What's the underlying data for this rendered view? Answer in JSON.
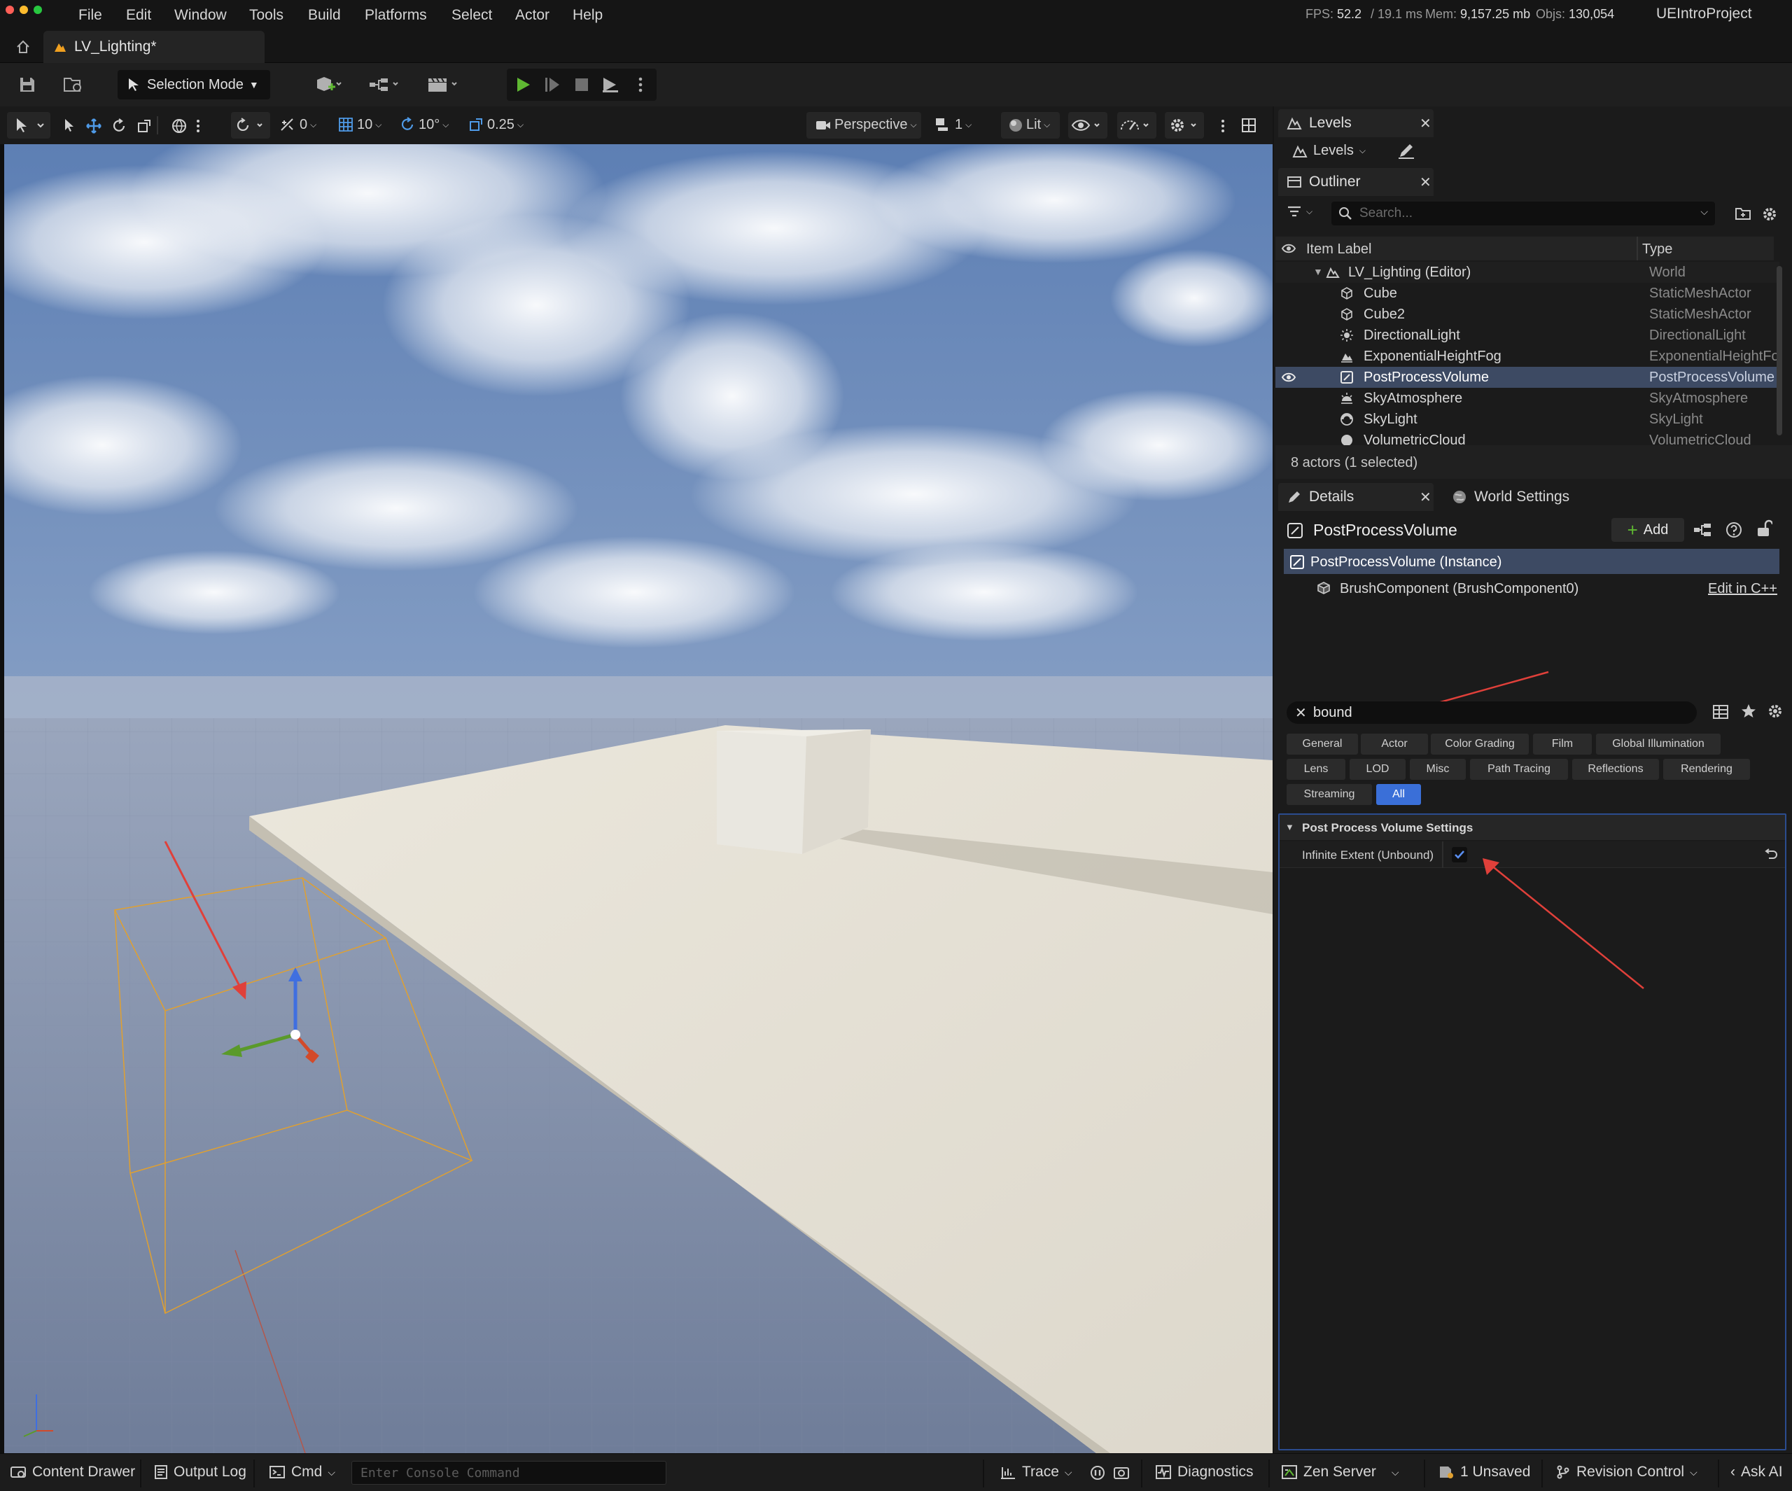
{
  "menu": [
    "File",
    "Edit",
    "Window",
    "Tools",
    "Build",
    "Platforms",
    "Select",
    "Actor",
    "Help"
  ],
  "stats": {
    "fps_label": "FPS:",
    "fps": "52.2",
    "ms": "/ 19.1 ms",
    "mem_label": "Mem:",
    "mem": "9,157.25 mb",
    "objs_label": "Objs:",
    "objs": "130,054"
  },
  "project_name": "UEIntroProject",
  "level_tab": "LV_Lighting*",
  "toolbar": {
    "selection_mode": "Selection Mode"
  },
  "viewport_toolbar": {
    "rot_snap": "0",
    "grid_snap": "10",
    "angle_snap": "10°",
    "scale_snap": "0.25",
    "view_mode": "Perspective",
    "camera_speed": "1",
    "lighting": "Lit"
  },
  "levels_panel": {
    "tab": "Levels",
    "dropdown": "Levels"
  },
  "outliner": {
    "tab": "Outliner",
    "search_placeholder": "Search...",
    "col_label": "Item Label",
    "col_type": "Type",
    "world": {
      "label": "LV_Lighting (Editor)",
      "type": "World"
    },
    "items": [
      {
        "label": "Cube",
        "type": "StaticMeshActor",
        "icon": "mesh-icon"
      },
      {
        "label": "Cube2",
        "type": "StaticMeshActor",
        "icon": "mesh-icon"
      },
      {
        "label": "DirectionalLight",
        "type": "DirectionalLight",
        "icon": "sun-icon"
      },
      {
        "label": "ExponentialHeightFog",
        "type": "ExponentialHeightFog",
        "icon": "fog-icon"
      },
      {
        "label": "PostProcessVolume",
        "type": "PostProcessVolume",
        "icon": "postprocess-icon",
        "selected": true
      },
      {
        "label": "SkyAtmosphere",
        "type": "SkyAtmosphere",
        "icon": "sky-icon"
      },
      {
        "label": "SkyLight",
        "type": "SkyLight",
        "icon": "skylight-icon"
      },
      {
        "label": "VolumetricCloud",
        "type": "VolumetricCloud",
        "icon": "cloud-icon"
      }
    ],
    "footer": "8 actors (1 selected)"
  },
  "details": {
    "tab": "Details",
    "world_settings_tab": "World Settings",
    "actor_name": "PostProcessVolume",
    "add_label": "Add",
    "instance": "PostProcessVolume (Instance)",
    "component": "BrushComponent (BrushComponent0)",
    "edit_cpp": "Edit in C++",
    "search_value": "bound",
    "filters": [
      [
        "General",
        "Actor",
        "Color Grading",
        "Film",
        "Global Illumination"
      ],
      [
        "Lens",
        "LOD",
        "Misc",
        "Path Tracing",
        "Reflections",
        "Rendering"
      ],
      [
        "Streaming",
        "All"
      ]
    ],
    "active_filter": "All",
    "section": "Post Process Volume Settings",
    "property_label": "Infinite Extent (Unbound)",
    "property_checked": true
  },
  "statusbar": {
    "content_drawer": "Content Drawer",
    "output_log": "Output Log",
    "cmd": "Cmd",
    "console_placeholder": "Enter Console Command",
    "trace": "Trace",
    "diagnostics": "Diagnostics",
    "zen_server": "Zen Server",
    "unsaved": "1 Unsaved",
    "revision_control": "Revision Control",
    "ask_ai": "Ask AI"
  },
  "colors": {
    "accent": "#3a6fd8",
    "selection": "#3d4a63",
    "play": "#5fb832",
    "annotation_arrow": "#e0403a",
    "selection_box": "#e0a030"
  }
}
